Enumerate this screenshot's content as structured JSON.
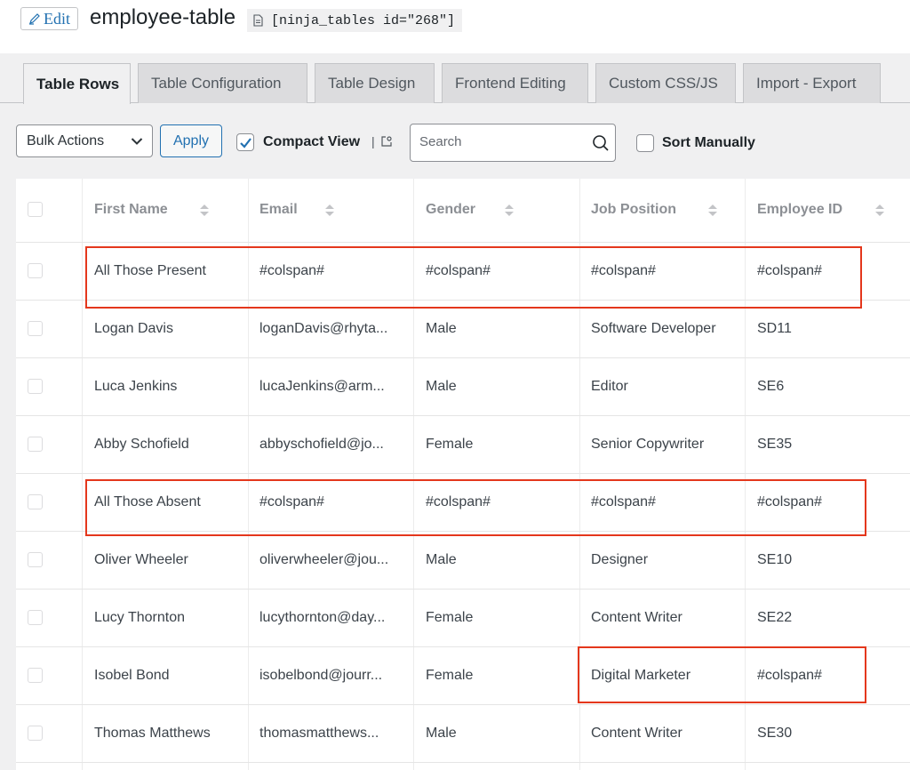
{
  "header": {
    "edit_label": "Edit",
    "title": "employee-table",
    "shortcode": "[ninja_tables id=\"268\"]"
  },
  "tabs": [
    {
      "label": "Table Rows",
      "active": true
    },
    {
      "label": "Table Configuration",
      "active": false
    },
    {
      "label": "Table Design",
      "active": false
    },
    {
      "label": "Frontend Editing",
      "active": false
    },
    {
      "label": "Custom CSS/JS",
      "active": false
    },
    {
      "label": "Import - Export",
      "active": false
    }
  ],
  "toolbar": {
    "bulk_actions": "Bulk Actions",
    "apply": "Apply",
    "compact_view": "Compact View",
    "compact_sep": "|",
    "compact_checked": true,
    "search_placeholder": "Search",
    "sort_manually": "Sort Manually",
    "sort_checked": false
  },
  "table": {
    "columns": [
      "First Name",
      "Email",
      "Gender",
      "Job Position",
      "Employee ID"
    ],
    "rows": [
      [
        "All Those Present",
        "#colspan#",
        "#colspan#",
        "#colspan#",
        "#colspan#"
      ],
      [
        "Logan Davis",
        "loganDavis@rhyta...",
        "Male",
        "Software Developer",
        "SD11"
      ],
      [
        "Luca Jenkins",
        "lucaJenkins@arm...",
        "Male",
        "Editor",
        "SE6"
      ],
      [
        "Abby Schofield",
        "abbyschofield@jo...",
        "Female",
        "Senior Copywriter",
        "SE35"
      ],
      [
        "All Those Absent",
        "#colspan#",
        "#colspan#",
        "#colspan#",
        "#colspan#"
      ],
      [
        "Oliver Wheeler",
        "oliverwheeler@jou...",
        "Male",
        "Designer",
        "SE10"
      ],
      [
        "Lucy Thornton",
        "lucythornton@day...",
        "Female",
        "Content Writer",
        "SE22"
      ],
      [
        "Isobel Bond",
        "isobelbond@jourr...",
        "Female",
        "Digital Marketer",
        "#colspan#"
      ],
      [
        "Thomas Matthews",
        "thomasmatthews...",
        "Male",
        "Content Writer",
        "SE30"
      ]
    ]
  },
  "colors": {
    "accent": "#2271b1",
    "highlight": "#e4371c"
  }
}
